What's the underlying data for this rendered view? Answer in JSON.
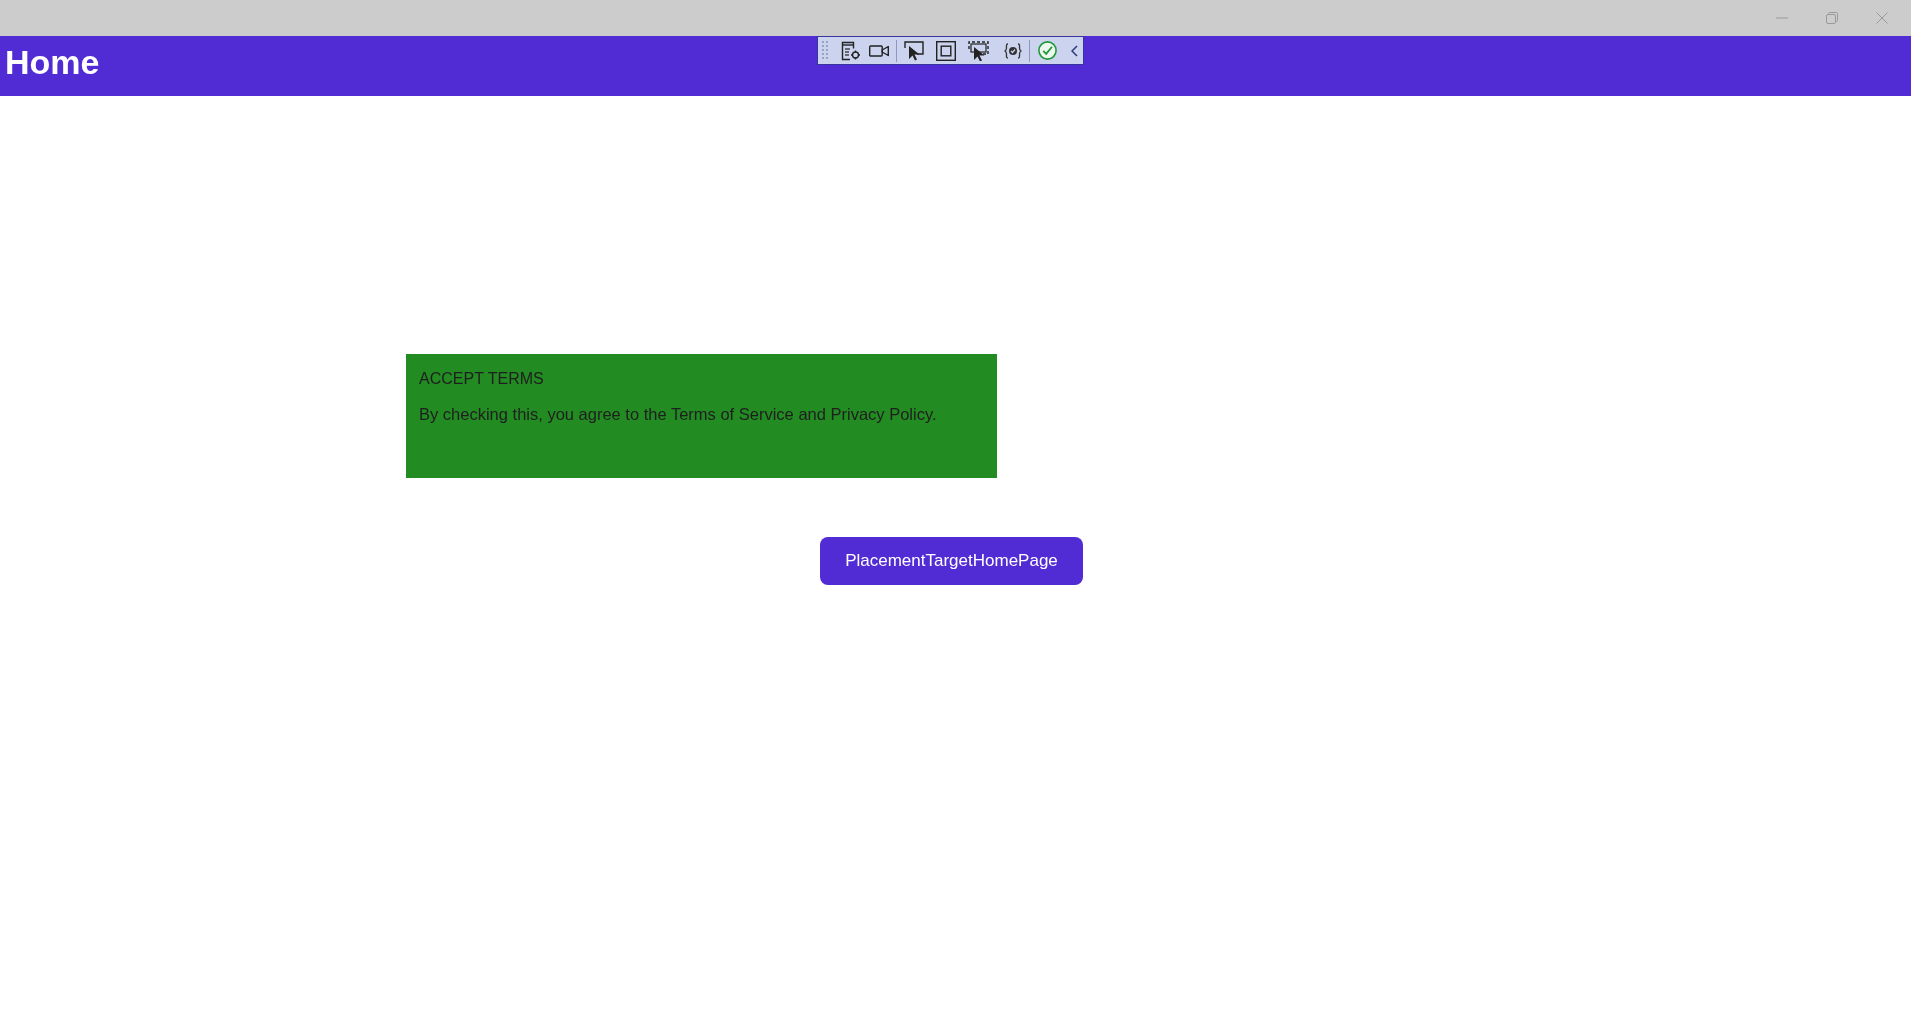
{
  "header": {
    "title": "Home"
  },
  "card": {
    "title": "ACCEPT TERMS",
    "text": "By checking this, you agree to the Terms of Service and Privacy Policy."
  },
  "button": {
    "label": "PlacementTargetHomePage"
  }
}
